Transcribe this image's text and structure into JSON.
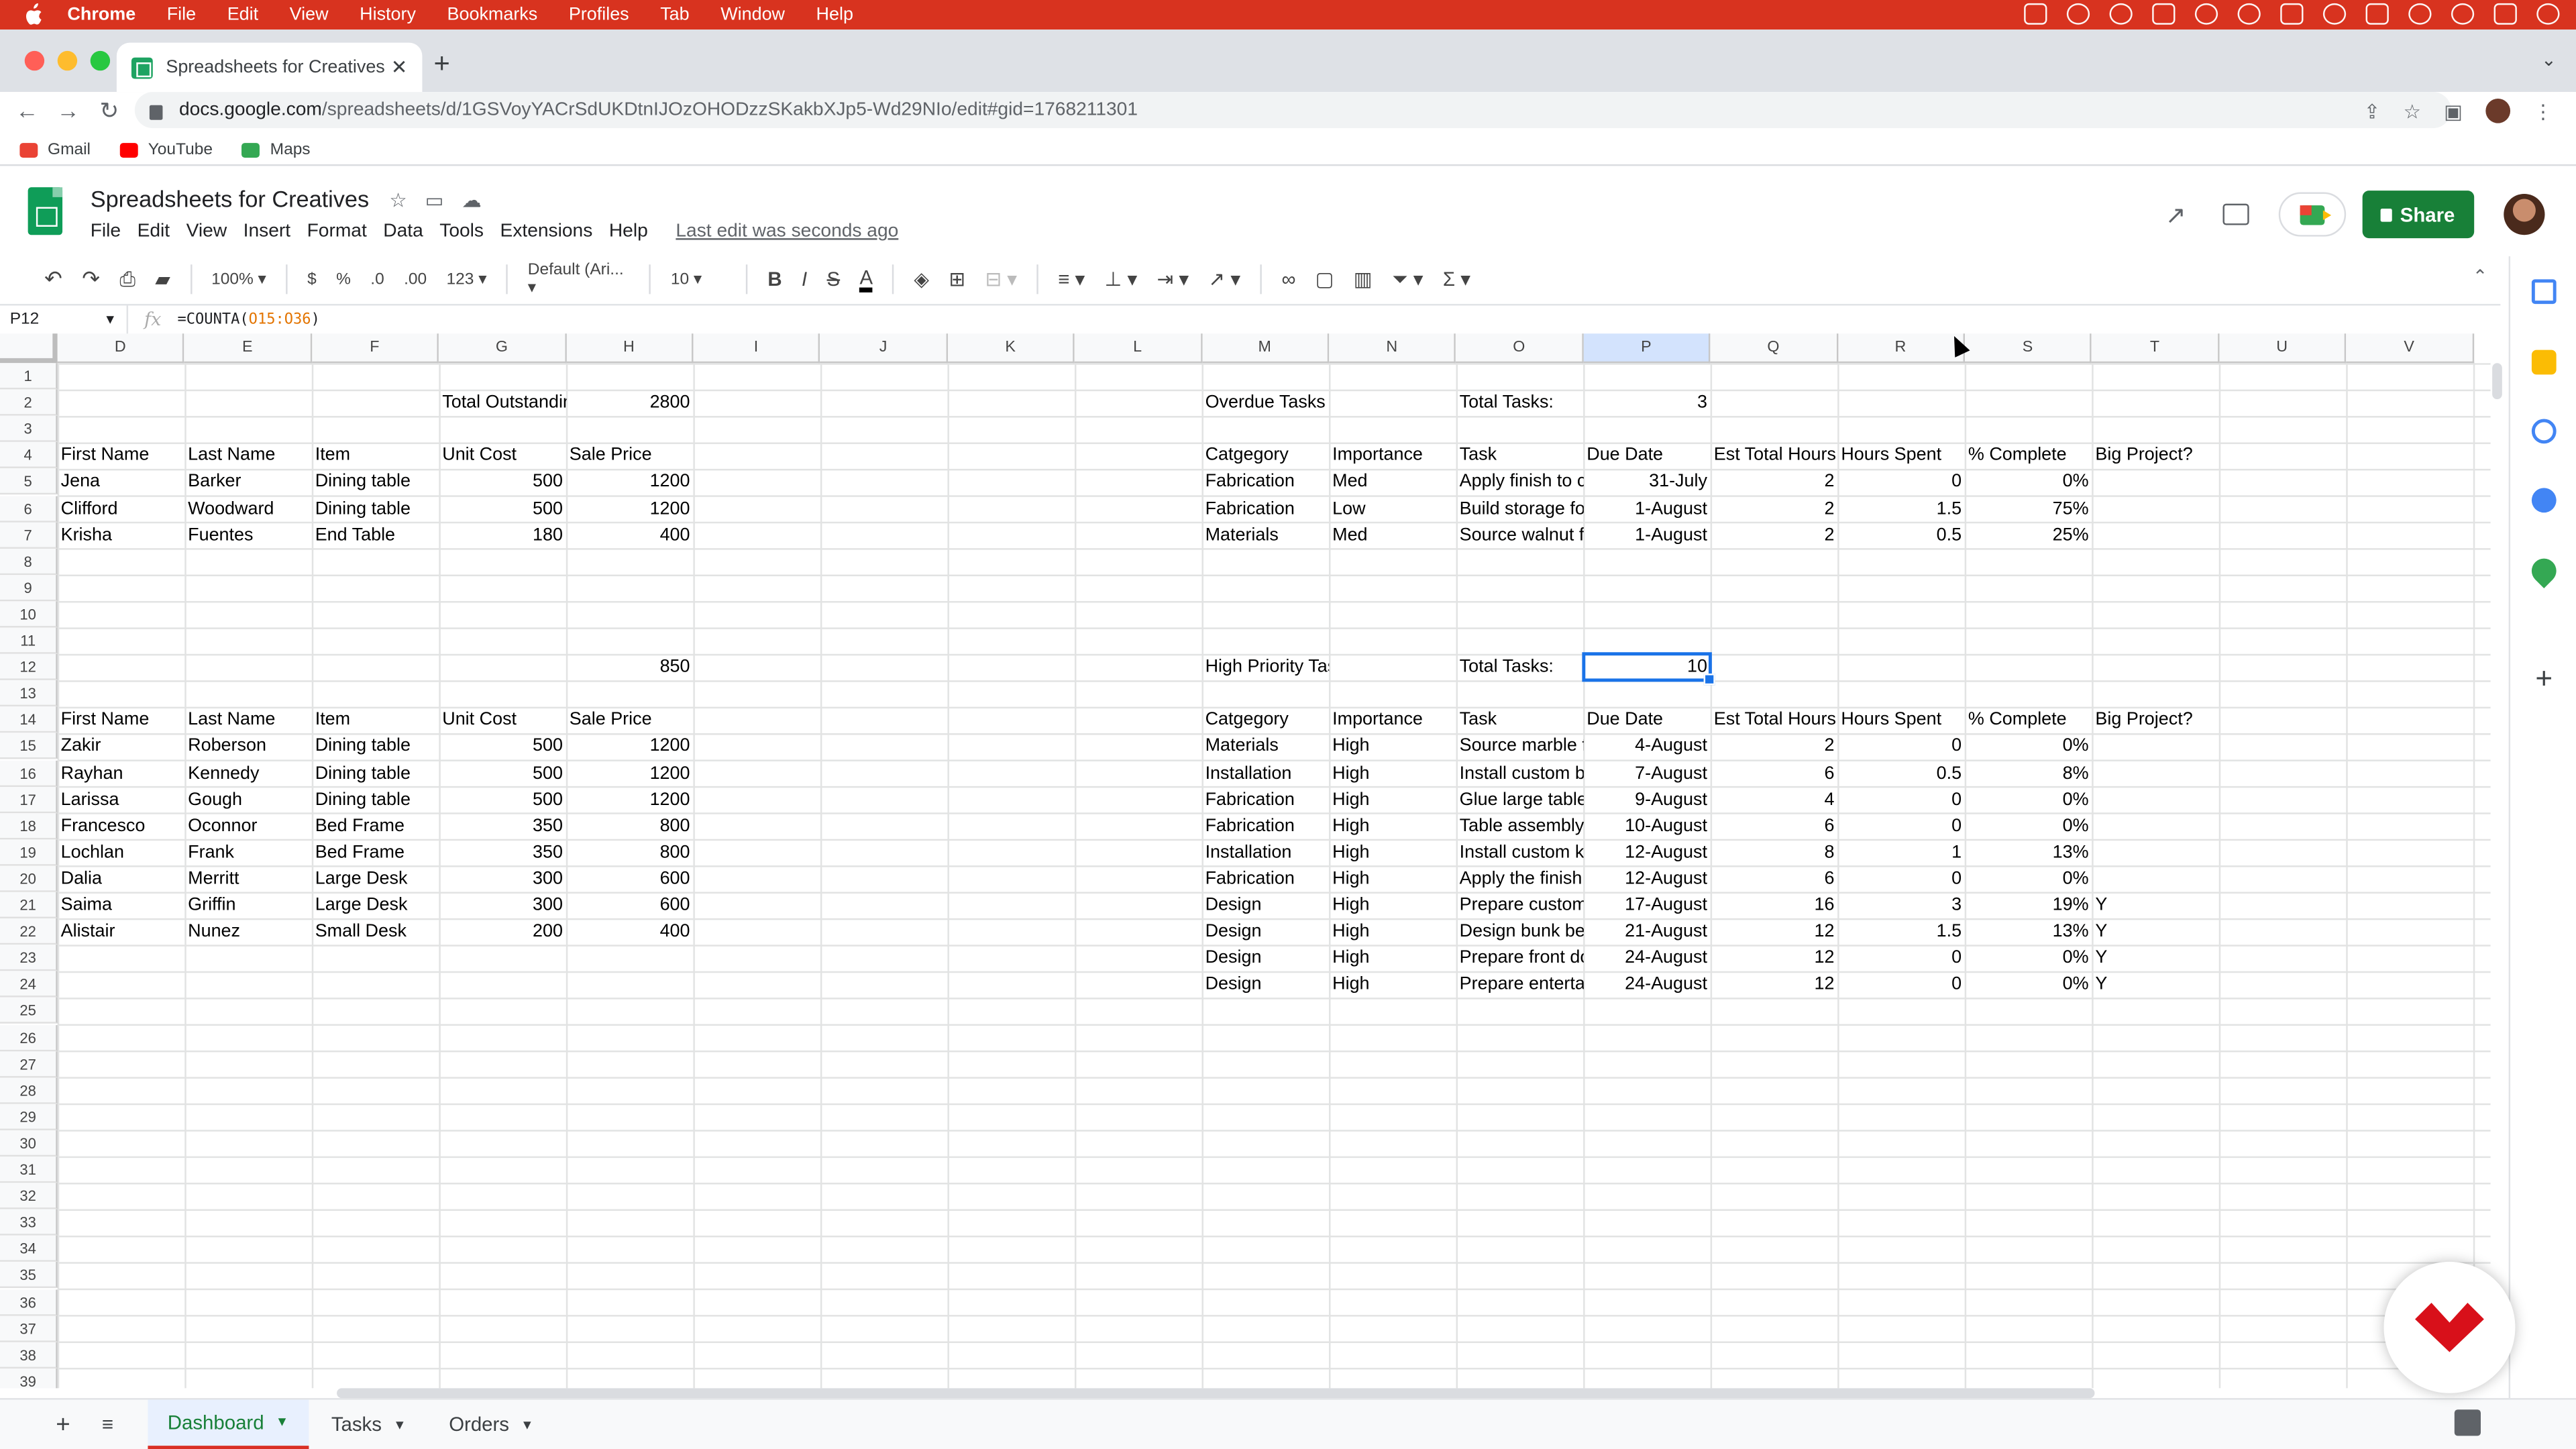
{
  "macos": {
    "app_name": "Chrome",
    "menu": [
      "File",
      "Edit",
      "View",
      "History",
      "Bookmarks",
      "Profiles",
      "Tab",
      "Window",
      "Help"
    ]
  },
  "browser": {
    "tab_title": "Spreadsheets for Creatives - G",
    "url_host": "docs.google.com",
    "url_path": "/spreadsheets/d/1GSVoyYACrSdUKDtnIJOzOHODzzSKakbXJp5-Wd29NIo/edit#gid=1768211301",
    "bookmarks": [
      {
        "label": "Gmail",
        "color": "#ea4335"
      },
      {
        "label": "YouTube",
        "color": "#ff0000"
      },
      {
        "label": "Maps",
        "color": "#34a853"
      }
    ]
  },
  "sheet": {
    "title": "Spreadsheets for Creatives",
    "menu": [
      "File",
      "Edit",
      "View",
      "Insert",
      "Format",
      "Data",
      "Tools",
      "Extensions",
      "Help"
    ],
    "last_edit": "Last edit was seconds ago",
    "share_label": "Share",
    "toolbar": {
      "zoom": "100%",
      "currency": "$",
      "percent": "%",
      "dec_less": ".0",
      "dec_more": ".00",
      "format": "123",
      "font": "Default (Ari...",
      "font_size": "10",
      "bold": "B",
      "italic": "I",
      "strike": "S",
      "text_color": "A"
    },
    "name_box": "P12",
    "formula_fn": "=COUNTA(",
    "formula_ref": "O15:O36",
    "formula_end": ")",
    "columns": [
      "D",
      "E",
      "F",
      "G",
      "H",
      "I",
      "J",
      "K",
      "L",
      "M",
      "N",
      "O",
      "P",
      "Q",
      "R",
      "S",
      "T",
      "U",
      "V"
    ],
    "selected_column": "P",
    "row_count": 39,
    "cells": [
      {
        "r": 2,
        "c": "G",
        "v": "Total Outstandin"
      },
      {
        "r": 2,
        "c": "H",
        "v": "2800",
        "n": true
      },
      {
        "r": 2,
        "c": "M",
        "v": "Overdue Tasks"
      },
      {
        "r": 2,
        "c": "O",
        "v": "Total Tasks:"
      },
      {
        "r": 2,
        "c": "P",
        "v": "3",
        "n": true
      },
      {
        "r": 4,
        "c": "D",
        "v": "First Name"
      },
      {
        "r": 4,
        "c": "E",
        "v": "Last Name"
      },
      {
        "r": 4,
        "c": "F",
        "v": "Item"
      },
      {
        "r": 4,
        "c": "G",
        "v": "Unit Cost"
      },
      {
        "r": 4,
        "c": "H",
        "v": "Sale Price"
      },
      {
        "r": 4,
        "c": "M",
        "v": "Catgegory"
      },
      {
        "r": 4,
        "c": "N",
        "v": "Importance"
      },
      {
        "r": 4,
        "c": "O",
        "v": "Task"
      },
      {
        "r": 4,
        "c": "P",
        "v": "Due Date"
      },
      {
        "r": 4,
        "c": "Q",
        "v": "Est Total Hours"
      },
      {
        "r": 4,
        "c": "R",
        "v": "Hours Spent"
      },
      {
        "r": 4,
        "c": "S",
        "v": "% Complete"
      },
      {
        "r": 4,
        "c": "T",
        "v": "Big Project?"
      },
      {
        "r": 5,
        "c": "D",
        "v": "Jena"
      },
      {
        "r": 5,
        "c": "E",
        "v": "Barker"
      },
      {
        "r": 5,
        "c": "F",
        "v": "Dining table"
      },
      {
        "r": 5,
        "c": "G",
        "v": "500",
        "n": true
      },
      {
        "r": 5,
        "c": "H",
        "v": "1200",
        "n": true
      },
      {
        "r": 5,
        "c": "M",
        "v": "Fabrication"
      },
      {
        "r": 5,
        "c": "N",
        "v": "Med"
      },
      {
        "r": 5,
        "c": "O",
        "v": "Apply finish to cu"
      },
      {
        "r": 5,
        "c": "P",
        "v": "31-July",
        "n": true
      },
      {
        "r": 5,
        "c": "Q",
        "v": "2",
        "n": true
      },
      {
        "r": 5,
        "c": "R",
        "v": "0",
        "n": true
      },
      {
        "r": 5,
        "c": "S",
        "v": "0%",
        "n": true
      },
      {
        "r": 6,
        "c": "D",
        "v": "Clifford"
      },
      {
        "r": 6,
        "c": "E",
        "v": "Woodward"
      },
      {
        "r": 6,
        "c": "F",
        "v": "Dining table"
      },
      {
        "r": 6,
        "c": "G",
        "v": "500",
        "n": true
      },
      {
        "r": 6,
        "c": "H",
        "v": "1200",
        "n": true
      },
      {
        "r": 6,
        "c": "M",
        "v": "Fabrication"
      },
      {
        "r": 6,
        "c": "N",
        "v": "Low"
      },
      {
        "r": 6,
        "c": "O",
        "v": "Build storage for"
      },
      {
        "r": 6,
        "c": "P",
        "v": "1-August",
        "n": true
      },
      {
        "r": 6,
        "c": "Q",
        "v": "2",
        "n": true
      },
      {
        "r": 6,
        "c": "R",
        "v": "1.5",
        "n": true
      },
      {
        "r": 6,
        "c": "S",
        "v": "75%",
        "n": true
      },
      {
        "r": 7,
        "c": "D",
        "v": "Krisha"
      },
      {
        "r": 7,
        "c": "E",
        "v": "Fuentes"
      },
      {
        "r": 7,
        "c": "F",
        "v": "End Table"
      },
      {
        "r": 7,
        "c": "G",
        "v": "180",
        "n": true
      },
      {
        "r": 7,
        "c": "H",
        "v": "400",
        "n": true
      },
      {
        "r": 7,
        "c": "M",
        "v": "Materials"
      },
      {
        "r": 7,
        "c": "N",
        "v": "Med"
      },
      {
        "r": 7,
        "c": "O",
        "v": "Source walnut fo"
      },
      {
        "r": 7,
        "c": "P",
        "v": "1-August",
        "n": true
      },
      {
        "r": 7,
        "c": "Q",
        "v": "2",
        "n": true
      },
      {
        "r": 7,
        "c": "R",
        "v": "0.5",
        "n": true
      },
      {
        "r": 7,
        "c": "S",
        "v": "25%",
        "n": true
      },
      {
        "r": 12,
        "c": "H",
        "v": "850",
        "n": true
      },
      {
        "r": 12,
        "c": "M",
        "v": "High Priority Tasks"
      },
      {
        "r": 12,
        "c": "O",
        "v": "Total Tasks:"
      },
      {
        "r": 12,
        "c": "P",
        "v": "10",
        "n": true
      },
      {
        "r": 14,
        "c": "D",
        "v": "First Name"
      },
      {
        "r": 14,
        "c": "E",
        "v": "Last Name"
      },
      {
        "r": 14,
        "c": "F",
        "v": "Item"
      },
      {
        "r": 14,
        "c": "G",
        "v": "Unit Cost"
      },
      {
        "r": 14,
        "c": "H",
        "v": "Sale Price"
      },
      {
        "r": 14,
        "c": "M",
        "v": "Catgegory"
      },
      {
        "r": 14,
        "c": "N",
        "v": "Importance"
      },
      {
        "r": 14,
        "c": "O",
        "v": "Task"
      },
      {
        "r": 14,
        "c": "P",
        "v": "Due Date"
      },
      {
        "r": 14,
        "c": "Q",
        "v": "Est Total Hours"
      },
      {
        "r": 14,
        "c": "R",
        "v": "Hours Spent"
      },
      {
        "r": 14,
        "c": "S",
        "v": "% Complete"
      },
      {
        "r": 14,
        "c": "T",
        "v": "Big Project?"
      },
      {
        "r": 15,
        "c": "D",
        "v": "Zakir"
      },
      {
        "r": 15,
        "c": "E",
        "v": "Roberson"
      },
      {
        "r": 15,
        "c": "F",
        "v": "Dining table"
      },
      {
        "r": 15,
        "c": "G",
        "v": "500",
        "n": true
      },
      {
        "r": 15,
        "c": "H",
        "v": "1200",
        "n": true
      },
      {
        "r": 15,
        "c": "M",
        "v": "Materials"
      },
      {
        "r": 15,
        "c": "N",
        "v": "High"
      },
      {
        "r": 15,
        "c": "O",
        "v": "Source marble fo"
      },
      {
        "r": 15,
        "c": "P",
        "v": "4-August",
        "n": true
      },
      {
        "r": 15,
        "c": "Q",
        "v": "2",
        "n": true
      },
      {
        "r": 15,
        "c": "R",
        "v": "0",
        "n": true
      },
      {
        "r": 15,
        "c": "S",
        "v": "0%",
        "n": true
      },
      {
        "r": 16,
        "c": "D",
        "v": "Rayhan"
      },
      {
        "r": 16,
        "c": "E",
        "v": "Kennedy"
      },
      {
        "r": 16,
        "c": "F",
        "v": "Dining table"
      },
      {
        "r": 16,
        "c": "G",
        "v": "500",
        "n": true
      },
      {
        "r": 16,
        "c": "H",
        "v": "1200",
        "n": true
      },
      {
        "r": 16,
        "c": "M",
        "v": "Installation"
      },
      {
        "r": 16,
        "c": "N",
        "v": "High"
      },
      {
        "r": 16,
        "c": "O",
        "v": "Install custom bc"
      },
      {
        "r": 16,
        "c": "P",
        "v": "7-August",
        "n": true
      },
      {
        "r": 16,
        "c": "Q",
        "v": "6",
        "n": true
      },
      {
        "r": 16,
        "c": "R",
        "v": "0.5",
        "n": true
      },
      {
        "r": 16,
        "c": "S",
        "v": "8%",
        "n": true
      },
      {
        "r": 17,
        "c": "D",
        "v": "Larissa"
      },
      {
        "r": 17,
        "c": "E",
        "v": "Gough"
      },
      {
        "r": 17,
        "c": "F",
        "v": "Dining table"
      },
      {
        "r": 17,
        "c": "G",
        "v": "500",
        "n": true
      },
      {
        "r": 17,
        "c": "H",
        "v": "1200",
        "n": true
      },
      {
        "r": 17,
        "c": "M",
        "v": "Fabrication"
      },
      {
        "r": 17,
        "c": "N",
        "v": "High"
      },
      {
        "r": 17,
        "c": "O",
        "v": "Glue large tablet"
      },
      {
        "r": 17,
        "c": "P",
        "v": "9-August",
        "n": true
      },
      {
        "r": 17,
        "c": "Q",
        "v": "4",
        "n": true
      },
      {
        "r": 17,
        "c": "R",
        "v": "0",
        "n": true
      },
      {
        "r": 17,
        "c": "S",
        "v": "0%",
        "n": true
      },
      {
        "r": 18,
        "c": "D",
        "v": "Francesco"
      },
      {
        "r": 18,
        "c": "E",
        "v": "Oconnor"
      },
      {
        "r": 18,
        "c": "F",
        "v": "Bed Frame"
      },
      {
        "r": 18,
        "c": "G",
        "v": "350",
        "n": true
      },
      {
        "r": 18,
        "c": "H",
        "v": "800",
        "n": true
      },
      {
        "r": 18,
        "c": "M",
        "v": "Fabrication"
      },
      {
        "r": 18,
        "c": "N",
        "v": "High"
      },
      {
        "r": 18,
        "c": "O",
        "v": "Table assembly"
      },
      {
        "r": 18,
        "c": "P",
        "v": "10-August",
        "n": true
      },
      {
        "r": 18,
        "c": "Q",
        "v": "6",
        "n": true
      },
      {
        "r": 18,
        "c": "R",
        "v": "0",
        "n": true
      },
      {
        "r": 18,
        "c": "S",
        "v": "0%",
        "n": true
      },
      {
        "r": 19,
        "c": "D",
        "v": "Lochlan"
      },
      {
        "r": 19,
        "c": "E",
        "v": "Frank"
      },
      {
        "r": 19,
        "c": "F",
        "v": "Bed Frame"
      },
      {
        "r": 19,
        "c": "G",
        "v": "350",
        "n": true
      },
      {
        "r": 19,
        "c": "H",
        "v": "800",
        "n": true
      },
      {
        "r": 19,
        "c": "M",
        "v": "Installation"
      },
      {
        "r": 19,
        "c": "N",
        "v": "High"
      },
      {
        "r": 19,
        "c": "O",
        "v": "Install custom kit"
      },
      {
        "r": 19,
        "c": "P",
        "v": "12-August",
        "n": true
      },
      {
        "r": 19,
        "c": "Q",
        "v": "8",
        "n": true
      },
      {
        "r": 19,
        "c": "R",
        "v": "1",
        "n": true
      },
      {
        "r": 19,
        "c": "S",
        "v": "13%",
        "n": true
      },
      {
        "r": 20,
        "c": "D",
        "v": "Dalia"
      },
      {
        "r": 20,
        "c": "E",
        "v": "Merritt"
      },
      {
        "r": 20,
        "c": "F",
        "v": "Large Desk"
      },
      {
        "r": 20,
        "c": "G",
        "v": "300",
        "n": true
      },
      {
        "r": 20,
        "c": "H",
        "v": "600",
        "n": true
      },
      {
        "r": 20,
        "c": "M",
        "v": "Fabrication"
      },
      {
        "r": 20,
        "c": "N",
        "v": "High"
      },
      {
        "r": 20,
        "c": "O",
        "v": "Apply the finish t"
      },
      {
        "r": 20,
        "c": "P",
        "v": "12-August",
        "n": true
      },
      {
        "r": 20,
        "c": "Q",
        "v": "6",
        "n": true
      },
      {
        "r": 20,
        "c": "R",
        "v": "0",
        "n": true
      },
      {
        "r": 20,
        "c": "S",
        "v": "0%",
        "n": true
      },
      {
        "r": 21,
        "c": "D",
        "v": "Saima"
      },
      {
        "r": 21,
        "c": "E",
        "v": "Griffin"
      },
      {
        "r": 21,
        "c": "F",
        "v": "Large Desk"
      },
      {
        "r": 21,
        "c": "G",
        "v": "300",
        "n": true
      },
      {
        "r": 21,
        "c": "H",
        "v": "600",
        "n": true
      },
      {
        "r": 21,
        "c": "M",
        "v": "Design"
      },
      {
        "r": 21,
        "c": "N",
        "v": "High"
      },
      {
        "r": 21,
        "c": "O",
        "v": "Prepare custom"
      },
      {
        "r": 21,
        "c": "P",
        "v": "17-August",
        "n": true
      },
      {
        "r": 21,
        "c": "Q",
        "v": "16",
        "n": true
      },
      {
        "r": 21,
        "c": "R",
        "v": "3",
        "n": true
      },
      {
        "r": 21,
        "c": "S",
        "v": "19%",
        "n": true
      },
      {
        "r": 21,
        "c": "T",
        "v": "Y"
      },
      {
        "r": 22,
        "c": "D",
        "v": "Alistair"
      },
      {
        "r": 22,
        "c": "E",
        "v": "Nunez"
      },
      {
        "r": 22,
        "c": "F",
        "v": "Small Desk"
      },
      {
        "r": 22,
        "c": "G",
        "v": "200",
        "n": true
      },
      {
        "r": 22,
        "c": "H",
        "v": "400",
        "n": true
      },
      {
        "r": 22,
        "c": "M",
        "v": "Design"
      },
      {
        "r": 22,
        "c": "N",
        "v": "High"
      },
      {
        "r": 22,
        "c": "O",
        "v": "Design bunk bec"
      },
      {
        "r": 22,
        "c": "P",
        "v": "21-August",
        "n": true
      },
      {
        "r": 22,
        "c": "Q",
        "v": "12",
        "n": true
      },
      {
        "r": 22,
        "c": "R",
        "v": "1.5",
        "n": true
      },
      {
        "r": 22,
        "c": "S",
        "v": "13%",
        "n": true
      },
      {
        "r": 22,
        "c": "T",
        "v": "Y"
      },
      {
        "r": 23,
        "c": "M",
        "v": "Design"
      },
      {
        "r": 23,
        "c": "N",
        "v": "High"
      },
      {
        "r": 23,
        "c": "O",
        "v": "Prepare front do"
      },
      {
        "r": 23,
        "c": "P",
        "v": "24-August",
        "n": true
      },
      {
        "r": 23,
        "c": "Q",
        "v": "12",
        "n": true
      },
      {
        "r": 23,
        "c": "R",
        "v": "0",
        "n": true
      },
      {
        "r": 23,
        "c": "S",
        "v": "0%",
        "n": true
      },
      {
        "r": 23,
        "c": "T",
        "v": "Y"
      },
      {
        "r": 24,
        "c": "M",
        "v": "Design"
      },
      {
        "r": 24,
        "c": "N",
        "v": "High"
      },
      {
        "r": 24,
        "c": "O",
        "v": "Prepare entertai"
      },
      {
        "r": 24,
        "c": "P",
        "v": "24-August",
        "n": true
      },
      {
        "r": 24,
        "c": "Q",
        "v": "12",
        "n": true
      },
      {
        "r": 24,
        "c": "R",
        "v": "0",
        "n": true
      },
      {
        "r": 24,
        "c": "S",
        "v": "0%",
        "n": true
      },
      {
        "r": 24,
        "c": "T",
        "v": "Y"
      }
    ],
    "selected_cell": {
      "r": 12,
      "c": "P"
    },
    "sheet_tabs": [
      {
        "label": "Dashboard",
        "active": true
      },
      {
        "label": "Tasks",
        "active": false
      },
      {
        "label": "Orders",
        "active": false
      }
    ]
  },
  "colors": {
    "mac_menubar": "#d8331f",
    "share_button": "#188038",
    "selection": "#1a73e8",
    "brand_logo": "#d8101a"
  }
}
